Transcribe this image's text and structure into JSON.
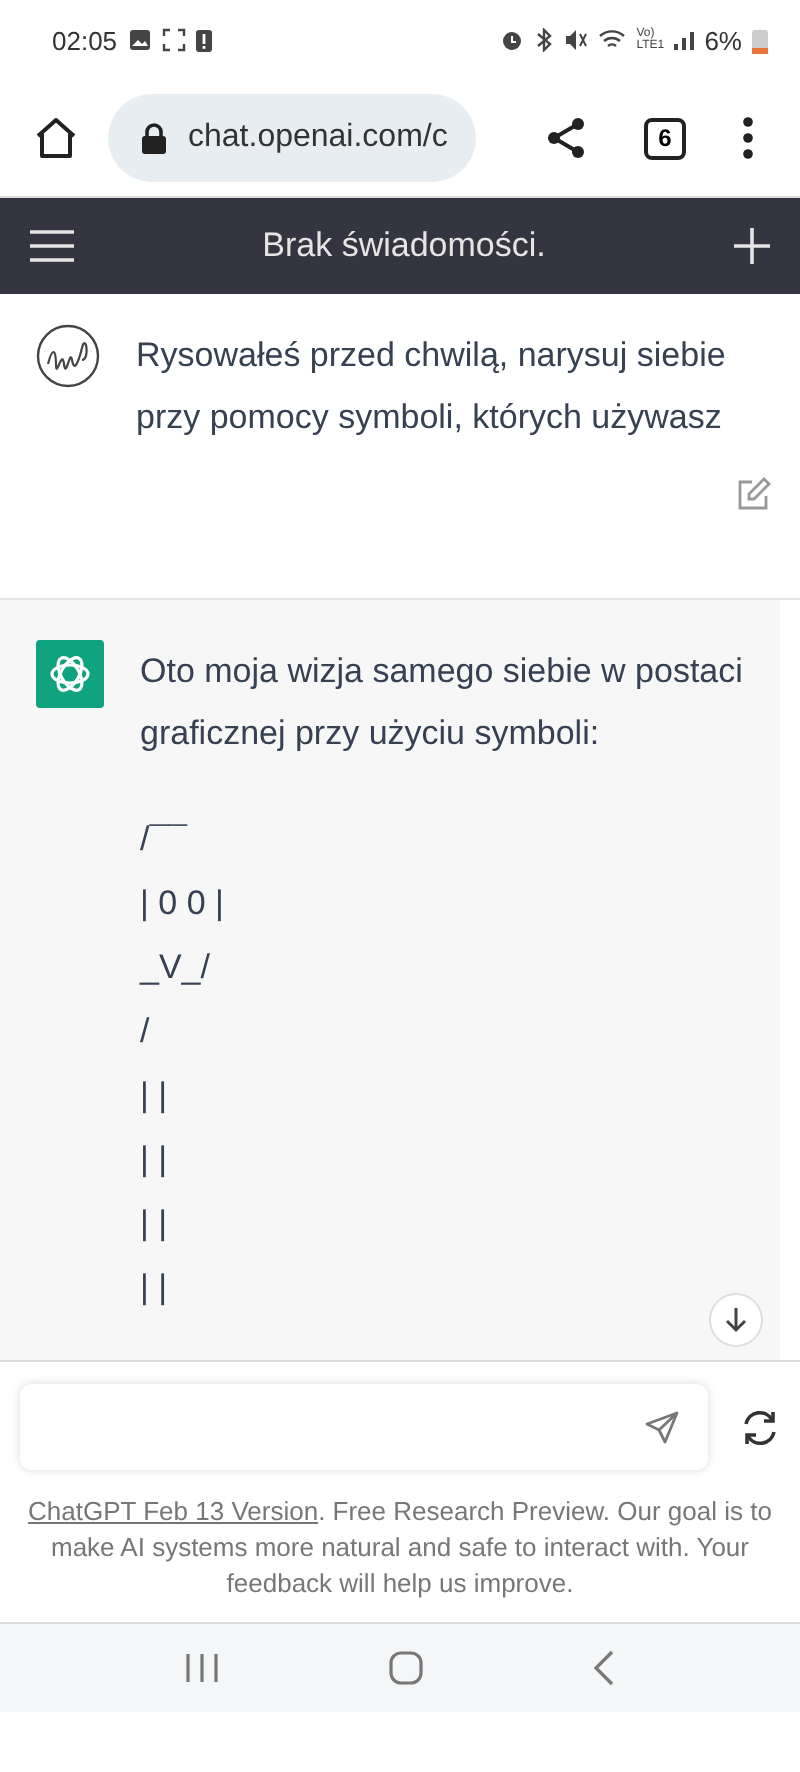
{
  "status_bar": {
    "time": "02:05",
    "network": "Vo) LTE1",
    "battery": "6%"
  },
  "browser": {
    "url": "chat.openai.com/c",
    "tab_count": "6"
  },
  "header": {
    "title": "Brak świadomości."
  },
  "messages": [
    {
      "kind": "user",
      "text": "Rysowałeś przed chwilą, narysuj siebie przy pomocy symboli, których używasz"
    },
    {
      "kind": "assistant",
      "text": "Oto moja wizja samego siebie w postaci graficznej przy użyciu symboli:",
      "lines": [
        "/¯¯",
        "| 0 0 |",
        "_V_/",
        "/",
        "| |",
        "| |",
        "| |",
        "| |"
      ]
    }
  ],
  "composer": {
    "footer_link": "ChatGPT Feb 13 Version",
    "footer_text": ". Free Research Preview. Our goal is to make AI systems more natural and safe to interact with. Your feedback will help us improve."
  }
}
